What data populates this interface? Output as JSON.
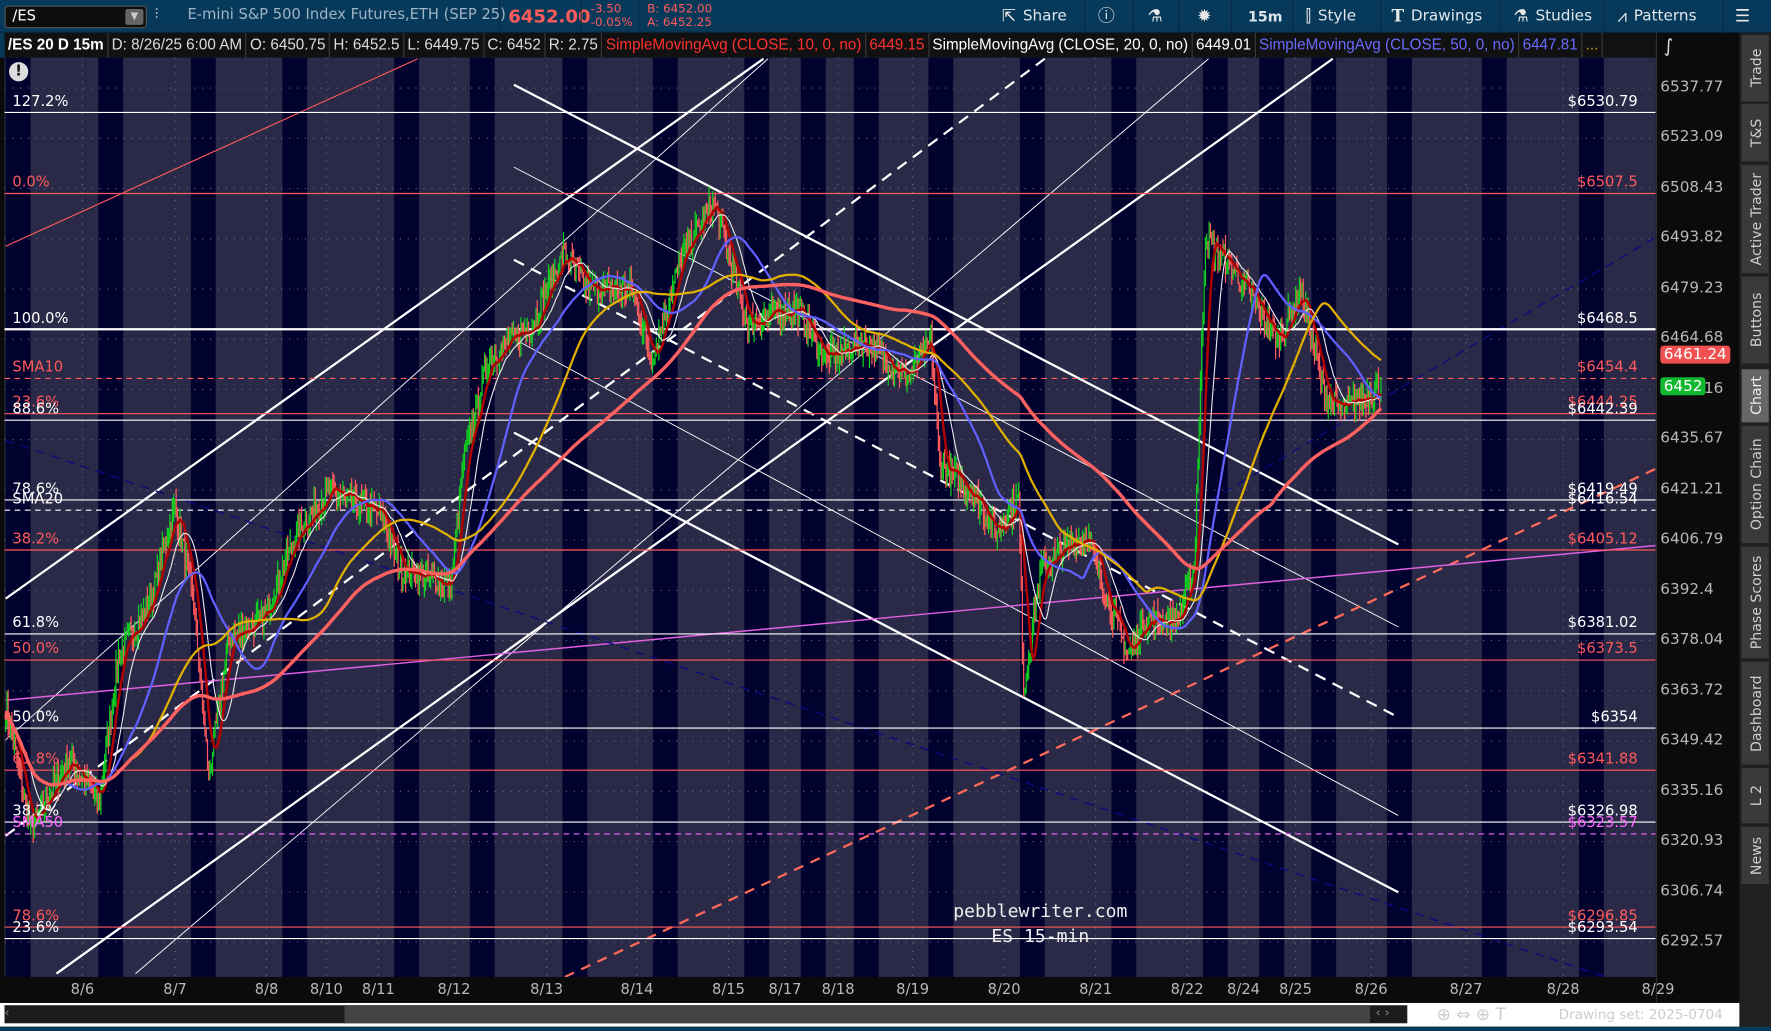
{
  "toolbar": {
    "symbol": "/ES",
    "description": "E-mini S&P 500 Index Futures,ETH (SEP 25)",
    "last": "6452.00",
    "change": "-3.50",
    "change_pct": "-0.05%",
    "bid": "B: 6452.00",
    "ask": "A: 6452.25",
    "buttons": {
      "share": "Share",
      "timeframe": "15m",
      "style": "Style",
      "drawings": "Drawings",
      "studies": "Studies",
      "patterns": "Patterns"
    }
  },
  "header": {
    "chart_id": "/ES 20 D 15m",
    "date": "D: 8/26/25 6:00 AM",
    "open": "O: 6450.75",
    "high": "H: 6452.5",
    "low": "L: 6449.75",
    "close": "C: 6452",
    "range": "R: 2.75",
    "studies": [
      {
        "name": "SimpleMovingAvg (CLOSE, 10, 0, no)",
        "value": "6449.15",
        "color": "#ff3030"
      },
      {
        "name": "SimpleMovingAvg (CLOSE, 20, 0, no)",
        "value": "6449.01",
        "color": "#ffffff"
      },
      {
        "name": "SimpleMovingAvg (CLOSE, 50, 0, no)",
        "value": "6447.81",
        "color": "#6a6aff"
      }
    ],
    "more": "..."
  },
  "price_axis": {
    "ticks": [
      "6537.77",
      "6523.09",
      "6508.43",
      "6493.82",
      "6479.23",
      "6464.68",
      "6450.16",
      "6435.67",
      "6421.21",
      "6406.79",
      "6392.4",
      "6378.04",
      "6363.72",
      "6349.42",
      "6335.16",
      "6320.93",
      "6306.74",
      "6292.57"
    ],
    "markers": [
      {
        "label": "6461.24",
        "price": 6461.24,
        "color": "#f05050"
      },
      {
        "label": "6452",
        "price": 6452,
        "color": "#10b830"
      }
    ]
  },
  "levels": [
    {
      "left": "127.2%",
      "right": "$6530.79",
      "price": 6530.79,
      "color": "#ffffff",
      "style": "solid"
    },
    {
      "left": "0.0%",
      "right": "$6507.5",
      "price": 6507.5,
      "color": "#ff5a5a",
      "style": "solid"
    },
    {
      "left": "100.0%",
      "right": "$6468.5",
      "price": 6468.5,
      "color": "#ffffff",
      "style": "double"
    },
    {
      "left": "SMA10",
      "right": "$6454.4",
      "price": 6454.4,
      "color": "#ff5a5a",
      "style": "dashed"
    },
    {
      "left": "23.6%",
      "right": "$6444.25",
      "price": 6444.25,
      "color": "#ff5a5a",
      "style": "solid"
    },
    {
      "left": "88.6%",
      "right": "$6442.39",
      "price": 6442.39,
      "color": "#ffffff",
      "style": "solid"
    },
    {
      "left": "78.6%",
      "right": "$6419.49",
      "price": 6419.49,
      "color": "#ffffff",
      "style": "solid"
    },
    {
      "left": "SMA20",
      "right": "$6416.54",
      "price": 6416.54,
      "color": "#ffffff",
      "style": "dashed"
    },
    {
      "left": "38.2%",
      "right": "$6405.12",
      "price": 6405.12,
      "color": "#ff5a5a",
      "style": "solid"
    },
    {
      "left": "61.8%",
      "right": "$6381.02",
      "price": 6381.02,
      "color": "#ffffff",
      "style": "solid"
    },
    {
      "left": "50.0%",
      "right": "$6373.5",
      "price": 6373.5,
      "color": "#ff5a5a",
      "style": "solid"
    },
    {
      "left": "50.0%",
      "right": "$6354",
      "price": 6354,
      "color": "#ffffff",
      "style": "solid"
    },
    {
      "left": "61.8%",
      "right": "$6341.88",
      "price": 6341.88,
      "color": "#ff5a5a",
      "style": "solid"
    },
    {
      "left": "38.2%",
      "right": "$6326.98",
      "price": 6326.98,
      "color": "#ffffff",
      "style": "solid"
    },
    {
      "left": "SMA50",
      "right": "$6323.57",
      "price": 6323.57,
      "color": "#ff66ff",
      "style": "dashed"
    },
    {
      "left": "78.6%",
      "right": "$6296.85",
      "price": 6296.85,
      "color": "#ff5a5a",
      "style": "solid"
    },
    {
      "left": "23.6%",
      "right": "$6293.54",
      "price": 6293.54,
      "color": "#ffffff",
      "style": "solid"
    }
  ],
  "dates": [
    "8/6",
    "8/7",
    "8/8",
    "8/10",
    "8/11",
    "8/12",
    "8/13",
    "8/14",
    "8/15",
    "8/17",
    "8/18",
    "8/19",
    "8/20",
    "8/21",
    "8/22",
    "8/24",
    "8/25",
    "8/26",
    "8/27",
    "8/28",
    "8/29"
  ],
  "price_path": [
    [
      0,
      6360
    ],
    [
      20,
      6325
    ],
    [
      50,
      6345
    ],
    [
      75,
      6333
    ],
    [
      90,
      6375
    ],
    [
      115,
      6390
    ],
    [
      135,
      6418
    ],
    [
      150,
      6390
    ],
    [
      162,
      6340
    ],
    [
      178,
      6380
    ],
    [
      205,
      6385
    ],
    [
      232,
      6410
    ],
    [
      258,
      6422
    ],
    [
      300,
      6415
    ],
    [
      315,
      6400
    ],
    [
      355,
      6395
    ],
    [
      365,
      6430
    ],
    [
      385,
      6460
    ],
    [
      420,
      6470
    ],
    [
      445,
      6490
    ],
    [
      465,
      6480
    ],
    [
      500,
      6480
    ],
    [
      515,
      6460
    ],
    [
      540,
      6490
    ],
    [
      565,
      6505
    ],
    [
      592,
      6470
    ],
    [
      630,
      6475
    ],
    [
      655,
      6460
    ],
    [
      685,
      6465
    ],
    [
      720,
      6455
    ],
    [
      738,
      6465
    ],
    [
      745,
      6430
    ],
    [
      775,
      6420
    ],
    [
      790,
      6410
    ],
    [
      808,
      6420
    ],
    [
      812,
      6365
    ],
    [
      826,
      6400
    ],
    [
      862,
      6410
    ],
    [
      880,
      6390
    ],
    [
      895,
      6375
    ],
    [
      908,
      6385
    ],
    [
      935,
      6385
    ],
    [
      948,
      6400
    ],
    [
      957,
      6495
    ],
    [
      980,
      6485
    ],
    [
      998,
      6475
    ],
    [
      1015,
      6465
    ],
    [
      1033,
      6480
    ],
    [
      1052,
      6450
    ],
    [
      1065,
      6445
    ],
    [
      1097,
      6452
    ]
  ],
  "watermark": {
    "line1": "pebblewriter.com",
    "line2": "ES 15-min"
  },
  "sidebar": [
    "Trade",
    "T&S",
    "Active Trader",
    "Buttons",
    "Chart",
    "Option Chain",
    "Phase Scores",
    "Dashboard",
    "L 2",
    "News"
  ],
  "scroll": {
    "drawing_set": "Drawing set: 2025-0704"
  },
  "colors": {
    "up": "#10d020",
    "down": "#ff5a5a",
    "session_dark": "#02022e",
    "session_light": "#2a2a48"
  }
}
